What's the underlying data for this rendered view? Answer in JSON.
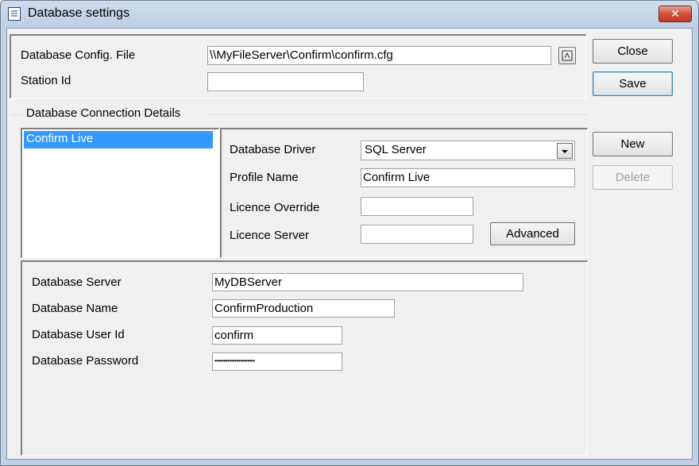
{
  "window": {
    "title": "Database settings",
    "icon": "list-window-icon",
    "close_icon": "close-icon"
  },
  "config": {
    "config_file_label": "Database Config. File",
    "config_file_value": "\\\\MyFileServer\\Confirm\\confirm.cfg",
    "browse_icon": "browse-icon",
    "station_label": "Station Id",
    "station_value": ""
  },
  "buttons": {
    "close": "Close",
    "save": "Save",
    "new": "New",
    "delete": "Delete",
    "advanced": "Advanced"
  },
  "connection": {
    "group_label": "Database Connection Details",
    "profiles": [
      "Confirm Live"
    ],
    "driver_label": "Database Driver",
    "driver_value": "SQL Server",
    "profile_name_label": "Profile Name",
    "profile_name_value": "Confirm Live",
    "licence_override_label": "Licence Override",
    "licence_override_value": "",
    "licence_server_label": "Licence Server",
    "licence_server_value": ""
  },
  "database": {
    "server_label": "Database Server",
    "server_value": "MyDBServer",
    "name_label": "Database Name",
    "name_value": "ConfirmProduction",
    "user_label": "Database User Id",
    "user_value": "confirm",
    "password_label": "Database Password",
    "password_value": "••••••••••••••••••••••"
  },
  "colors": {
    "selection": "#3399ff",
    "close_button": "#c23a22",
    "title_bar": "#bfd0e6"
  }
}
